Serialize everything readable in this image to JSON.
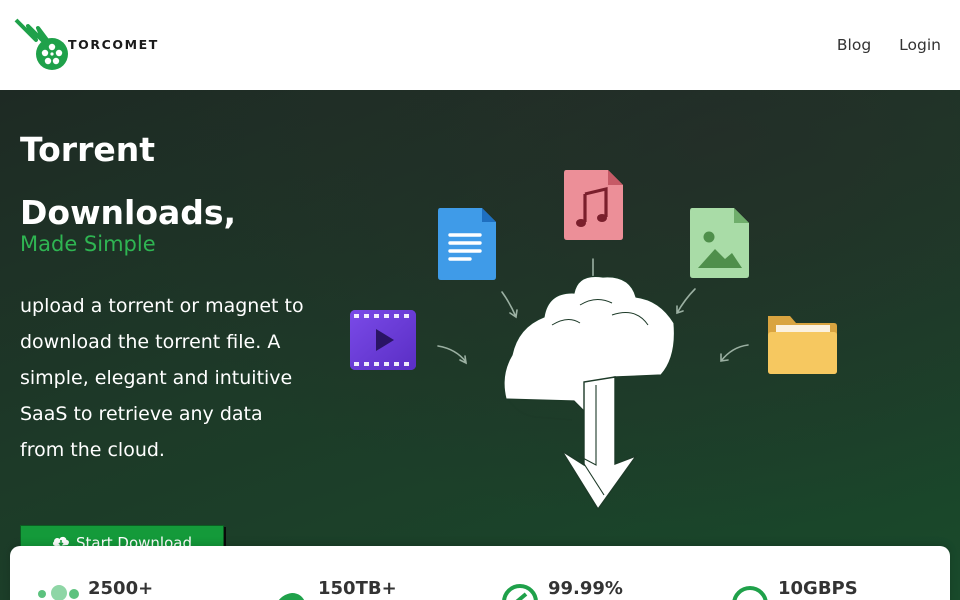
{
  "brand": {
    "name": "TORCOMET",
    "color": "#1fa14a"
  },
  "nav": {
    "items": [
      {
        "label": "Blog"
      },
      {
        "label": "Login"
      }
    ]
  },
  "hero": {
    "title_line1": "Torrent",
    "title_line2": "Downloads,",
    "subtitle": "Made Simple",
    "description": "upload a torrent or magnet to download the torrent file. A simple, elegant and intuitive SaaS to retrieve any data from the cloud.",
    "cta_label": "Start Download"
  },
  "illustration": {
    "icons": [
      "video-file-icon",
      "document-file-icon",
      "music-file-icon",
      "image-file-icon",
      "folder-icon",
      "cloud-download-icon"
    ]
  },
  "stats": [
    {
      "value": "2500+",
      "icon": "users-icon"
    },
    {
      "value": "150TB+",
      "icon": "storage-icon"
    },
    {
      "value": "99.99%",
      "icon": "uptime-icon"
    },
    {
      "value": "10GBPS",
      "icon": "speed-icon"
    }
  ],
  "colors": {
    "accent": "#2fb552",
    "button": "#149a3a",
    "hero_bg": "#1d3a28"
  }
}
